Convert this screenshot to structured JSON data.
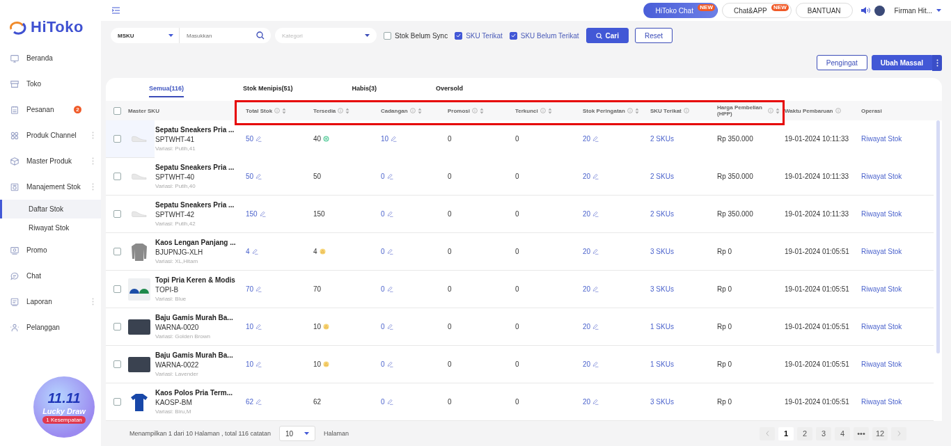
{
  "sidebar": {
    "logo": "HiToko",
    "items": [
      {
        "label": "Beranda",
        "expandable": false,
        "selected": false
      },
      {
        "label": "Toko",
        "expandable": false,
        "selected": false
      },
      {
        "label": "Pesanan",
        "badge": "2",
        "expandable": false,
        "selected": false
      },
      {
        "label": "Produk Channel",
        "expandable": true,
        "selected": false
      },
      {
        "label": "Master Produk",
        "expandable": true,
        "selected": false
      },
      {
        "label": "Manajement Stok",
        "expandable": true,
        "selected": false,
        "children": [
          {
            "label": "Daftar Stok",
            "selected": true
          },
          {
            "label": "Riwayat Stok",
            "selected": false
          }
        ]
      },
      {
        "label": "Promo",
        "expandable": false,
        "selected": false
      },
      {
        "label": "Chat",
        "expandable": false,
        "selected": false
      },
      {
        "label": "Laporan",
        "expandable": true,
        "selected": false
      },
      {
        "label": "Pelanggan",
        "expandable": false,
        "selected": false
      }
    ],
    "promo": {
      "title": "11.11",
      "subtitle": "Lucky Draw",
      "tag": "1 Kesempatan"
    }
  },
  "topbar": {
    "buttons": [
      {
        "label": "HiToko Chat",
        "kind": "primary",
        "badge": "NEW"
      },
      {
        "label": "Chat&APP",
        "kind": "outline",
        "badge": "NEW"
      },
      {
        "label": "BANTUAN",
        "kind": "outline"
      }
    ],
    "user": "Firman Hit..."
  },
  "filters": {
    "field_select": "MSKU",
    "search": {
      "placeholder": "Masukkan"
    },
    "category": {
      "placeholder": "Kategori"
    },
    "checkboxes": [
      {
        "label": "Stok Belum Sync",
        "checked": false
      },
      {
        "label": "SKU Terikat",
        "checked": true
      },
      {
        "label": "SKU Belum Terikat",
        "checked": true
      }
    ],
    "search_button": "Cari",
    "reset_button": "Reset"
  },
  "actions": {
    "reminder_button": "Pengingat",
    "bulk_button": "Ubah Massal"
  },
  "tabs": [
    {
      "label": "Semua(116)",
      "selected": true
    },
    {
      "label": "Stok Menipis(51)",
      "selected": false
    },
    {
      "label": "Habis(3)",
      "selected": false
    },
    {
      "label": "Oversold",
      "selected": false
    }
  ],
  "table": {
    "select_all": {
      "checked": false
    },
    "columns": [
      {
        "label": "Master SKU",
        "info": false,
        "sortable": false
      },
      {
        "label": "Total Stok",
        "info": true,
        "sortable": true
      },
      {
        "label": "Tersedia",
        "info": true,
        "sortable": true
      },
      {
        "label": "Cadangan",
        "info": true,
        "sortable": true
      },
      {
        "label": "Promosi",
        "info": true,
        "sortable": true
      },
      {
        "label": "Terkunci",
        "info": true,
        "sortable": true
      },
      {
        "label": "Stok Peringatan",
        "info": true,
        "sortable": true
      },
      {
        "label": "SKU Terikat",
        "info": true,
        "sortable": false
      },
      {
        "label": "Harga Pembelian (HPP)",
        "info": true,
        "sortable": true
      },
      {
        "label": "Waktu Pembaruan",
        "info": true,
        "sortable": false
      },
      {
        "label": "Operasi",
        "info": false,
        "sortable": false
      }
    ],
    "rows": [
      {
        "highlighted": true,
        "checked": false,
        "kind": "shoe",
        "name": "Sepatu Sneakers Pria ...",
        "sku": "SPTWHT-41",
        "variant": "Variasi: Putih,41",
        "total": "50",
        "available": "40",
        "in_sync": true,
        "low_stock": false,
        "reserved": "10",
        "promo": "0",
        "locked": "0",
        "warning": "20",
        "linked": "2 SKUs",
        "price": "Rp 350.000",
        "updated": "19-01-2024 10:11:33",
        "operation": "Riwayat Stok"
      },
      {
        "highlighted": false,
        "checked": false,
        "kind": "shoe",
        "name": "Sepatu Sneakers Pria ...",
        "sku": "SPTWHT-40",
        "variant": "Variasi: Putih,40",
        "total": "50",
        "available": "50",
        "in_sync": false,
        "low_stock": false,
        "reserved": "0",
        "promo": "0",
        "locked": "0",
        "warning": "20",
        "linked": "2 SKUs",
        "price": "Rp 350.000",
        "updated": "19-01-2024 10:11:33",
        "operation": "Riwayat Stok"
      },
      {
        "highlighted": false,
        "checked": false,
        "kind": "shoe",
        "name": "Sepatu Sneakers Pria ...",
        "sku": "SPTWHT-42",
        "variant": "Variasi: Putih,42",
        "total": "150",
        "available": "150",
        "in_sync": false,
        "low_stock": false,
        "reserved": "0",
        "promo": "0",
        "locked": "0",
        "warning": "20",
        "linked": "2 SKUs",
        "price": "Rp 350.000",
        "updated": "19-01-2024 10:11:33",
        "operation": "Riwayat Stok"
      },
      {
        "highlighted": false,
        "checked": false,
        "kind": "sweater",
        "name": "Kaos Lengan Panjang ...",
        "sku": "BJUPNJG-XLH",
        "variant": "Variasi: XL,Hitam",
        "total": "4",
        "available": "4",
        "in_sync": false,
        "low_stock": true,
        "reserved": "0",
        "promo": "0",
        "locked": "0",
        "warning": "20",
        "linked": "3 SKUs",
        "price": "Rp 0",
        "updated": "19-01-2024 01:05:51",
        "operation": "Riwayat Stok"
      },
      {
        "highlighted": false,
        "checked": false,
        "kind": "caps",
        "name": "Topi Pria Keren & Modis",
        "sku": "TOPI-B",
        "variant": "Variasi: Blue",
        "total": "70",
        "available": "70",
        "in_sync": false,
        "low_stock": false,
        "reserved": "0",
        "promo": "0",
        "locked": "0",
        "warning": "20",
        "linked": "3 SKUs",
        "price": "Rp 0",
        "updated": "19-01-2024 01:05:51",
        "operation": "Riwayat Stok"
      },
      {
        "highlighted": false,
        "checked": false,
        "kind": "photo",
        "name": "Baju Gamis Murah Ba...",
        "sku": "WARNA-0020",
        "variant": "Variasi: Golden Brown",
        "total": "10",
        "available": "10",
        "in_sync": false,
        "low_stock": true,
        "reserved": "0",
        "promo": "0",
        "locked": "0",
        "warning": "20",
        "linked": "1 SKUs",
        "price": "Rp 0",
        "updated": "19-01-2024 01:05:51",
        "operation": "Riwayat Stok"
      },
      {
        "highlighted": false,
        "checked": false,
        "kind": "photo",
        "name": "Baju Gamis Murah Ba...",
        "sku": "WARNA-0022",
        "variant": "Variasi: Lavender",
        "total": "10",
        "available": "10",
        "in_sync": false,
        "low_stock": true,
        "reserved": "0",
        "promo": "0",
        "locked": "0",
        "warning": "20",
        "linked": "1 SKUs",
        "price": "Rp 0",
        "updated": "19-01-2024 01:05:51",
        "operation": "Riwayat Stok"
      },
      {
        "highlighted": false,
        "checked": false,
        "kind": "tshirt",
        "name": "Kaos Polos Pria Term...",
        "sku": "KAOSP-BM",
        "variant": "Variasi: Biru,M",
        "total": "62",
        "available": "62",
        "in_sync": false,
        "low_stock": false,
        "reserved": "0",
        "promo": "0",
        "locked": "0",
        "warning": "20",
        "linked": "3 SKUs",
        "price": "Rp 0",
        "updated": "19-01-2024 01:05:51",
        "operation": "Riwayat Stok"
      }
    ]
  },
  "footer": {
    "summary": "Menampilkan 1 dari 10 Halaman , total 116 catatan",
    "page_size": "10",
    "page_size_label": "Halaman",
    "pages": [
      {
        "label": "1",
        "selected": true
      },
      {
        "label": "2",
        "selected": false
      },
      {
        "label": "3",
        "selected": false
      },
      {
        "label": "4",
        "selected": false
      },
      {
        "label": "•••",
        "selected": false
      },
      {
        "label": "12",
        "selected": false
      }
    ]
  }
}
